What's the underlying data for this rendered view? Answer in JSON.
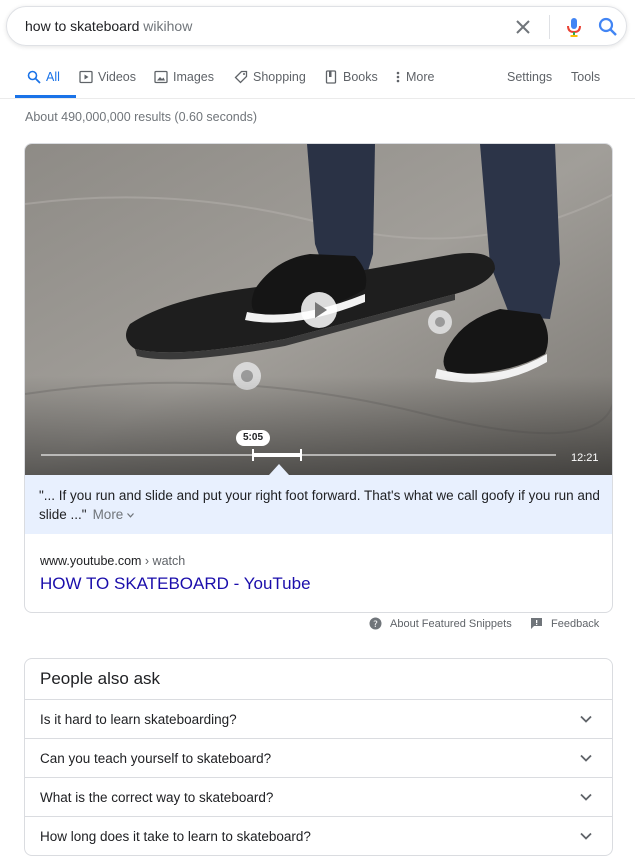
{
  "search": {
    "query": "how to skateboard",
    "suggestion_suffix": "wikihow"
  },
  "icons": {
    "clear": "close-icon",
    "mic": "microphone-icon",
    "search": "search-icon"
  },
  "colors": {
    "accent": "#1a73e8",
    "link": "#1a0dab",
    "snippet_bg": "#e8f0fe"
  },
  "tabs": {
    "all": "All",
    "videos": "Videos",
    "images": "Images",
    "shopping": "Shopping",
    "books": "Books",
    "more": "More",
    "settings": "Settings",
    "tools": "Tools"
  },
  "results_stats": "About 490,000,000 results (0.60 seconds)",
  "featured": {
    "video": {
      "timestamp": "5:05",
      "duration": "12:21",
      "progress_fraction": 0.41
    },
    "quote": "\"... If you run and slide and put your right foot forward. That's what we call goofy if you run and slide ...\"",
    "more_label": "More",
    "url_domain": "www.youtube.com",
    "url_path": "› watch",
    "title": "HOW TO SKATEBOARD - YouTube"
  },
  "snippet_footer": {
    "about": "About Featured Snippets",
    "feedback": "Feedback"
  },
  "paa": {
    "title": "People also ask",
    "questions": [
      "Is it hard to learn skateboarding?",
      "Can you teach yourself to skateboard?",
      "What is the correct way to skateboard?",
      "How long does it take to learn to skateboard?"
    ]
  }
}
